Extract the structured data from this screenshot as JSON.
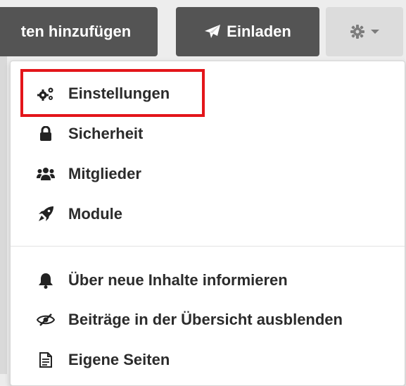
{
  "toolbar": {
    "add_label": "ten hinzufügen",
    "invite_label": "Einladen",
    "settings_icon": "gear-icon"
  },
  "menu": {
    "items": [
      {
        "label": "Einstellungen",
        "icon": "cogs-icon"
      },
      {
        "label": "Sicherheit",
        "icon": "lock-icon"
      },
      {
        "label": "Mitglieder",
        "icon": "users-icon"
      },
      {
        "label": "Module",
        "icon": "rocket-icon"
      },
      {
        "label": "Über neue Inhalte informieren",
        "icon": "bell-icon"
      },
      {
        "label": "Beiträge in der Übersicht ausblenden",
        "icon": "eye-slash-icon"
      },
      {
        "label": "Eigene Seiten",
        "icon": "file-text-icon"
      }
    ]
  },
  "highlight": {
    "color": "#e3151a",
    "target": "Einstellungen"
  },
  "colors": {
    "dark_button": "#545454",
    "gear_button": "#dcdcdc",
    "text": "#2b2b2b"
  }
}
